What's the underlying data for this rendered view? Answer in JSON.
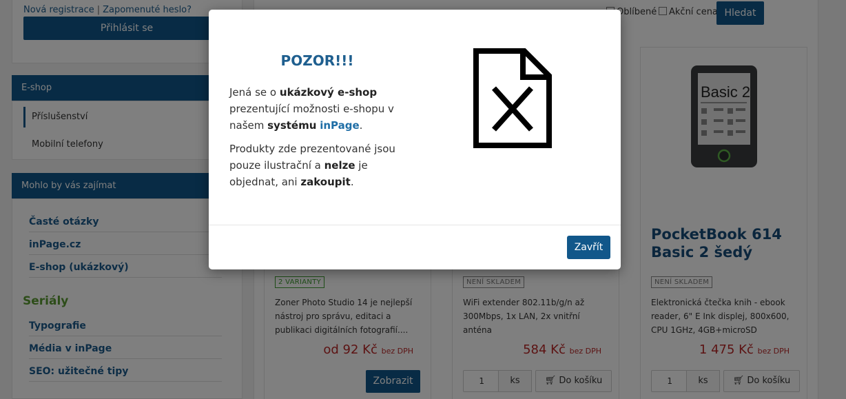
{
  "sidebar": {
    "register_link": "Nová registrace",
    "forgot_link": "Zapomenuté heslo?",
    "login_button": "Přihlásit se",
    "eshop_heading": "E-shop",
    "categories": [
      "Příslušenství",
      "Mobilní telefony"
    ],
    "interest_heading": "Mohlo by vás zajímat",
    "interest_links": [
      "Časté otázky",
      "inPage.cz",
      "E-shop (ukázkový)"
    ],
    "series_heading": "Seriály",
    "series_links": [
      "Typografie",
      "Média v inPage",
      "SEO: užitečné tipy"
    ]
  },
  "filters": {
    "favorites_label": "Oblíbené",
    "sale_label": "Akční cena",
    "search_button": "Hledat"
  },
  "products": [
    {
      "badge": "2 VARIANTY",
      "description": "Zoner Photo Studio 14 je nejlepší nástroj pro správu, editaci a publikaci digitálních fotografií....",
      "price": "od 92 Kč",
      "price_note": "bez DPH",
      "button": "Zobrazit"
    },
    {
      "badge": "NENÍ SKLADEM",
      "description": "WiFi extender 802.11b/g/n až 300Mbps, 1x LAN, 2x vnitřní anténa",
      "price": "584 Kč",
      "price_note": "bez DPH",
      "qty": "1",
      "unit": "ks",
      "button": "Do košíku"
    },
    {
      "title": "PocketBook 614 Basic 2 šedý",
      "screen_text": "Basic 2",
      "badge": "NENÍ SKLADEM",
      "description": "Elektronická čtečka knih - ebook reader, 6\" E Ink displej, 800x600, CPU 1GHz, 4GB+microSD",
      "price": "1 475 Kč",
      "price_note": "bez DPH",
      "qty": "1",
      "unit": "ks",
      "button": "Do košíku"
    }
  ],
  "modal": {
    "title": "POZOR!!!",
    "p1_a": "Jená se o ",
    "p1_b": "ukázkový e-shop",
    "p1_c": " prezentující možnosti e-shopu v našem ",
    "p1_d": "systému",
    "p1_e": " ",
    "p1_f": "inPage",
    "p1_g": ".",
    "p2_a": "Produkty zde prezentované jsou pouze ilustrační a ",
    "p2_b": "nelze",
    "p2_c": " je objednat, ani ",
    "p2_d": "zakoupit",
    "p2_e": ".",
    "close_button": "Zavřít",
    "icon": "document-x-icon"
  },
  "colors": {
    "primary": "#11578a",
    "title_blue": "#1f5f8f",
    "price_red": "#b82727",
    "series_green": "#5b9a33"
  }
}
